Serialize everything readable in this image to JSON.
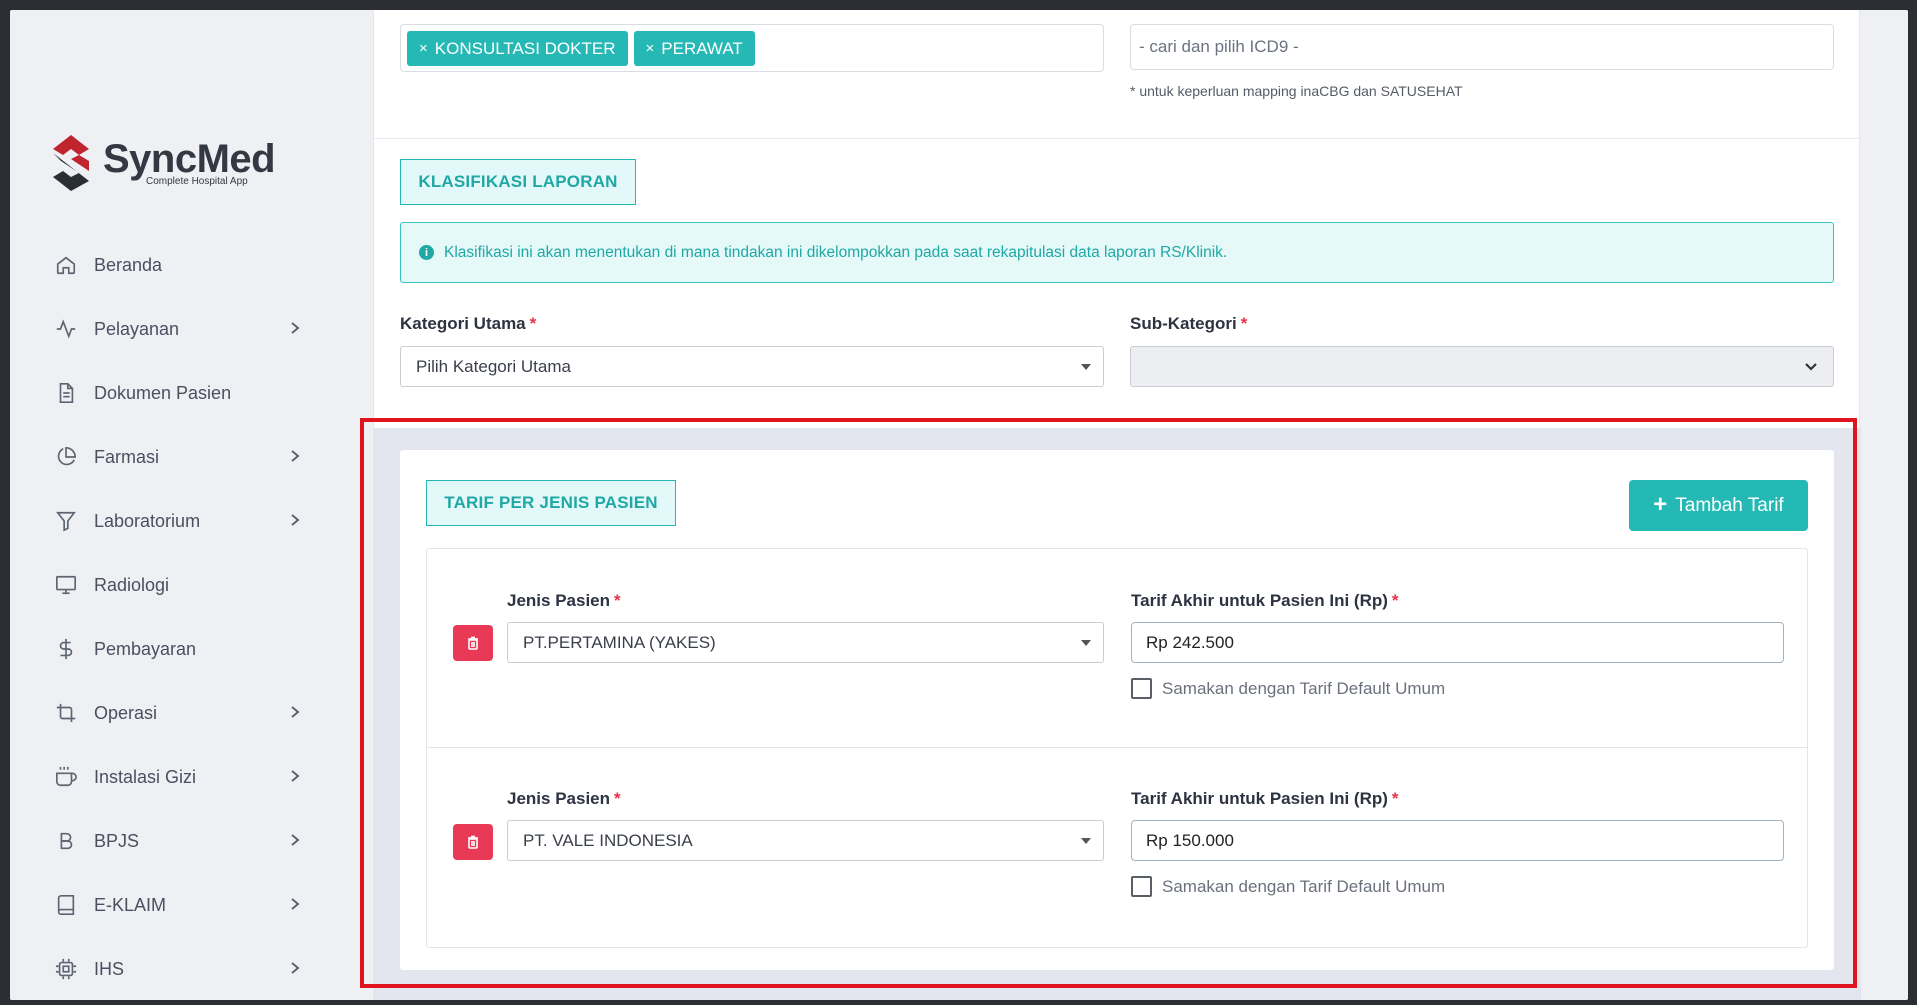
{
  "brand": {
    "name": "SyncMed",
    "tagline": "Complete Hospital App"
  },
  "sidebar": {
    "items": [
      {
        "label": "Beranda",
        "icon": "home-icon",
        "has_submenu": false
      },
      {
        "label": "Pelayanan",
        "icon": "activity-icon",
        "has_submenu": true
      },
      {
        "label": "Dokumen Pasien",
        "icon": "document-icon",
        "has_submenu": false
      },
      {
        "label": "Farmasi",
        "icon": "pie-chart-icon",
        "has_submenu": true
      },
      {
        "label": "Laboratorium",
        "icon": "filter-icon",
        "has_submenu": true
      },
      {
        "label": "Radiologi",
        "icon": "monitor-icon",
        "has_submenu": false
      },
      {
        "label": "Pembayaran",
        "icon": "dollar-icon",
        "has_submenu": false
      },
      {
        "label": "Operasi",
        "icon": "crop-icon",
        "has_submenu": true
      },
      {
        "label": "Instalasi Gizi",
        "icon": "coffee-icon",
        "has_submenu": true
      },
      {
        "label": "BPJS",
        "icon": "bold-b-icon",
        "has_submenu": true
      },
      {
        "label": "E-KLAIM",
        "icon": "book-icon",
        "has_submenu": true
      },
      {
        "label": "IHS",
        "icon": "cpu-icon",
        "has_submenu": true
      }
    ]
  },
  "top": {
    "tags": [
      "KONSULTASI DOKTER",
      "PERAWAT"
    ],
    "icd9_placeholder": "- cari dan pilih  ICD9 -",
    "icd9_note": "* untuk keperluan mapping inaCBG dan SATUSEHAT"
  },
  "klasifikasi": {
    "section_label": "KLASIFIKASI LAPORAN",
    "info": "Klasifikasi ini akan menentukan di mana tindakan ini dikelompokkan pada saat rekapitulasi data laporan RS/Klinik.",
    "kategori_label": "Kategori Utama",
    "kategori_value": "Pilih Kategori Utama",
    "sub_label": "Sub-Kategori",
    "sub_value": "",
    "required_mark": "*"
  },
  "tarif": {
    "section_label": "TARIF PER JENIS PASIEN",
    "add_label": "Tambah Tarif",
    "rows": [
      {
        "jenis_label": "Jenis Pasien",
        "jenis_value": "PT.PERTAMINA (YAKES)",
        "tarif_label": "Tarif Akhir untuk Pasien Ini (Rp)",
        "tarif_value": "Rp 242.500",
        "checkbox_label": "Samakan dengan Tarif Default Umum",
        "checked": false
      },
      {
        "jenis_label": "Jenis Pasien",
        "jenis_value": "PT. VALE INDONESIA",
        "tarif_label": "Tarif Akhir untuk Pasien Ini (Rp)",
        "tarif_value": "Rp 150.000",
        "checkbox_label": "Samakan dengan Tarif Default Umum",
        "checked": false
      }
    ]
  },
  "colors": {
    "accent": "#26b8b5",
    "danger": "#e83a56",
    "highlight": "#e0141e"
  }
}
